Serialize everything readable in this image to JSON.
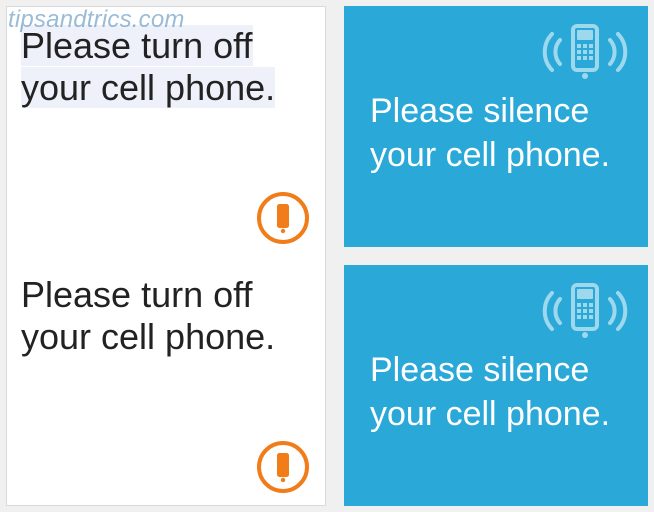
{
  "watermark": "tipsandtrics.com",
  "colors": {
    "blue_card_bg": "#2aa8d8",
    "orange_accent": "#f07c1a",
    "watermark_text": "#4a86b8"
  },
  "left": {
    "cards": [
      {
        "message": "Please turn off your cell phone.",
        "icon": "phone-icon"
      },
      {
        "message": "Please turn off your cell phone.",
        "icon": "phone-icon"
      }
    ]
  },
  "right": {
    "cards": [
      {
        "message": "Please silence your cell phone.",
        "icon": "phone-ringing-icon"
      },
      {
        "message": "Please silence your cell phone.",
        "icon": "phone-ringing-icon"
      }
    ]
  }
}
